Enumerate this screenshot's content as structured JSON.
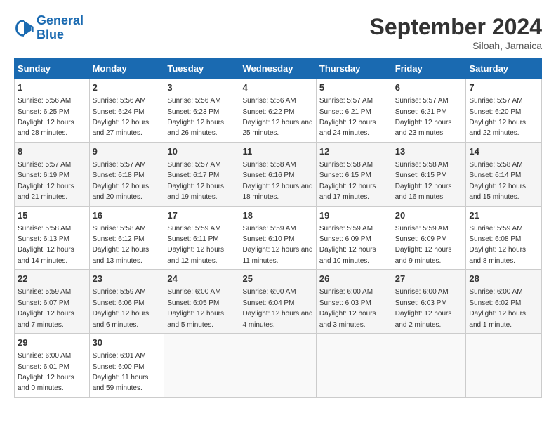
{
  "header": {
    "logo_line1": "General",
    "logo_line2": "Blue",
    "month": "September 2024",
    "location": "Siloah, Jamaica"
  },
  "days_of_week": [
    "Sunday",
    "Monday",
    "Tuesday",
    "Wednesday",
    "Thursday",
    "Friday",
    "Saturday"
  ],
  "weeks": [
    [
      {
        "day": "1",
        "sunrise": "5:56 AM",
        "sunset": "6:25 PM",
        "daylight": "12 hours and 28 minutes."
      },
      {
        "day": "2",
        "sunrise": "5:56 AM",
        "sunset": "6:24 PM",
        "daylight": "12 hours and 27 minutes."
      },
      {
        "day": "3",
        "sunrise": "5:56 AM",
        "sunset": "6:23 PM",
        "daylight": "12 hours and 26 minutes."
      },
      {
        "day": "4",
        "sunrise": "5:56 AM",
        "sunset": "6:22 PM",
        "daylight": "12 hours and 25 minutes."
      },
      {
        "day": "5",
        "sunrise": "5:57 AM",
        "sunset": "6:21 PM",
        "daylight": "12 hours and 24 minutes."
      },
      {
        "day": "6",
        "sunrise": "5:57 AM",
        "sunset": "6:21 PM",
        "daylight": "12 hours and 23 minutes."
      },
      {
        "day": "7",
        "sunrise": "5:57 AM",
        "sunset": "6:20 PM",
        "daylight": "12 hours and 22 minutes."
      }
    ],
    [
      {
        "day": "8",
        "sunrise": "5:57 AM",
        "sunset": "6:19 PM",
        "daylight": "12 hours and 21 minutes."
      },
      {
        "day": "9",
        "sunrise": "5:57 AM",
        "sunset": "6:18 PM",
        "daylight": "12 hours and 20 minutes."
      },
      {
        "day": "10",
        "sunrise": "5:57 AM",
        "sunset": "6:17 PM",
        "daylight": "12 hours and 19 minutes."
      },
      {
        "day": "11",
        "sunrise": "5:58 AM",
        "sunset": "6:16 PM",
        "daylight": "12 hours and 18 minutes."
      },
      {
        "day": "12",
        "sunrise": "5:58 AM",
        "sunset": "6:15 PM",
        "daylight": "12 hours and 17 minutes."
      },
      {
        "day": "13",
        "sunrise": "5:58 AM",
        "sunset": "6:15 PM",
        "daylight": "12 hours and 16 minutes."
      },
      {
        "day": "14",
        "sunrise": "5:58 AM",
        "sunset": "6:14 PM",
        "daylight": "12 hours and 15 minutes."
      }
    ],
    [
      {
        "day": "15",
        "sunrise": "5:58 AM",
        "sunset": "6:13 PM",
        "daylight": "12 hours and 14 minutes."
      },
      {
        "day": "16",
        "sunrise": "5:58 AM",
        "sunset": "6:12 PM",
        "daylight": "12 hours and 13 minutes."
      },
      {
        "day": "17",
        "sunrise": "5:59 AM",
        "sunset": "6:11 PM",
        "daylight": "12 hours and 12 minutes."
      },
      {
        "day": "18",
        "sunrise": "5:59 AM",
        "sunset": "6:10 PM",
        "daylight": "12 hours and 11 minutes."
      },
      {
        "day": "19",
        "sunrise": "5:59 AM",
        "sunset": "6:09 PM",
        "daylight": "12 hours and 10 minutes."
      },
      {
        "day": "20",
        "sunrise": "5:59 AM",
        "sunset": "6:09 PM",
        "daylight": "12 hours and 9 minutes."
      },
      {
        "day": "21",
        "sunrise": "5:59 AM",
        "sunset": "6:08 PM",
        "daylight": "12 hours and 8 minutes."
      }
    ],
    [
      {
        "day": "22",
        "sunrise": "5:59 AM",
        "sunset": "6:07 PM",
        "daylight": "12 hours and 7 minutes."
      },
      {
        "day": "23",
        "sunrise": "5:59 AM",
        "sunset": "6:06 PM",
        "daylight": "12 hours and 6 minutes."
      },
      {
        "day": "24",
        "sunrise": "6:00 AM",
        "sunset": "6:05 PM",
        "daylight": "12 hours and 5 minutes."
      },
      {
        "day": "25",
        "sunrise": "6:00 AM",
        "sunset": "6:04 PM",
        "daylight": "12 hours and 4 minutes."
      },
      {
        "day": "26",
        "sunrise": "6:00 AM",
        "sunset": "6:03 PM",
        "daylight": "12 hours and 3 minutes."
      },
      {
        "day": "27",
        "sunrise": "6:00 AM",
        "sunset": "6:03 PM",
        "daylight": "12 hours and 2 minutes."
      },
      {
        "day": "28",
        "sunrise": "6:00 AM",
        "sunset": "6:02 PM",
        "daylight": "12 hours and 1 minute."
      }
    ],
    [
      {
        "day": "29",
        "sunrise": "6:00 AM",
        "sunset": "6:01 PM",
        "daylight": "12 hours and 0 minutes."
      },
      {
        "day": "30",
        "sunrise": "6:01 AM",
        "sunset": "6:00 PM",
        "daylight": "11 hours and 59 minutes."
      },
      null,
      null,
      null,
      null,
      null
    ]
  ]
}
